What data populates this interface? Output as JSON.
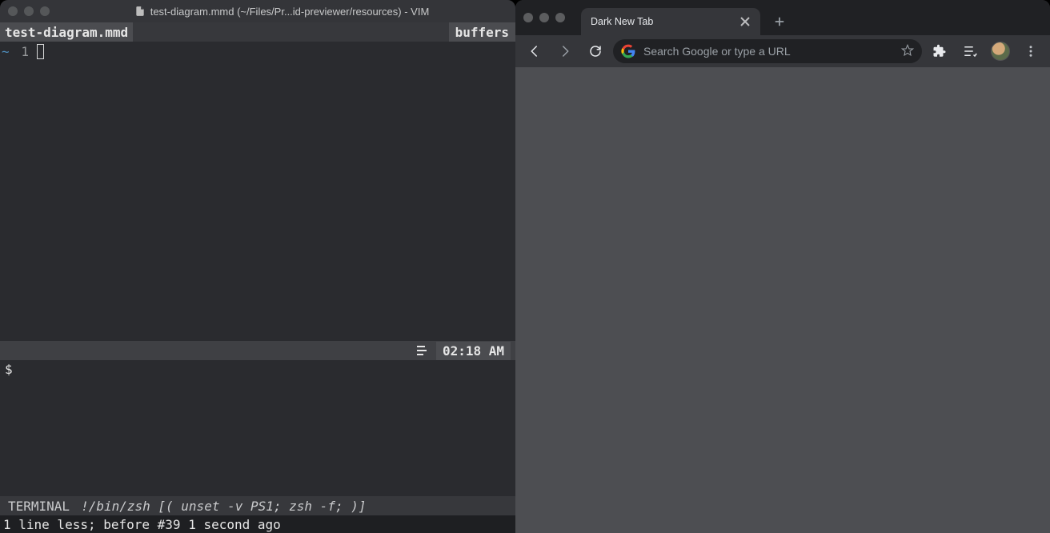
{
  "vim": {
    "titlebar": "test-diagram.mmd (~/Files/Pr...id-previewer/resources) - VIM",
    "tab_filename": "test-diagram.mmd",
    "tab_right_label": "buffers",
    "gutter_tilde": "~",
    "line_number": "1",
    "status_time": "02:18 AM",
    "terminal_prompt": "$",
    "mode_label": "TERMINAL",
    "shell_info": "!/bin/zsh [( unset -v PS1; zsh -f; )]",
    "message": "1 line less; before #39  1 second ago"
  },
  "chrome": {
    "tab_title": "Dark New Tab",
    "omnibox_placeholder": "Search Google or type a URL"
  }
}
